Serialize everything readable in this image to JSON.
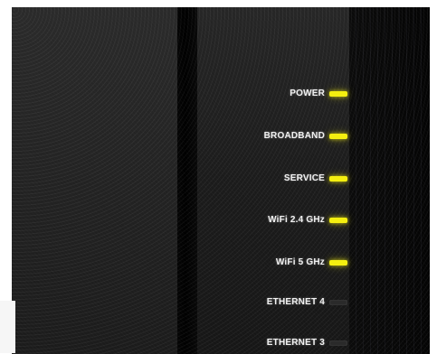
{
  "status_panel": {
    "indicators": [
      {
        "label": "POWER",
        "state": "on",
        "color": "#f4ef10"
      },
      {
        "label": "BROADBAND",
        "state": "on",
        "color": "#f4ef10"
      },
      {
        "label": "SERVICE",
        "state": "on",
        "color": "#f4ef10"
      },
      {
        "label": "WiFi 2.4 GHz",
        "state": "on",
        "color": "#f4ef10"
      },
      {
        "label": "WiFi  5 GHz",
        "state": "on",
        "color": "#f4ef10"
      },
      {
        "label": "ETHERNET 4",
        "state": "off",
        "color": "#2a2a2a"
      },
      {
        "label": "ETHERNET 3",
        "state": "off",
        "color": "#2a2a2a"
      }
    ]
  }
}
